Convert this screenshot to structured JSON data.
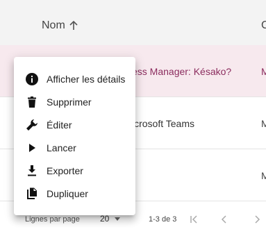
{
  "table": {
    "columns": {
      "name": "Nom",
      "next": "C"
    },
    "rows": [
      {
        "title": "ess Manager: Késako?",
        "c": "M"
      },
      {
        "title": "icrosoft Teams",
        "c": "M"
      },
      {
        "title": "",
        "c": "M"
      }
    ]
  },
  "menu": {
    "items": [
      {
        "label": "Afficher les détails",
        "icon": "info-icon"
      },
      {
        "label": "Supprimer",
        "icon": "trash-icon"
      },
      {
        "label": "Éditer",
        "icon": "wrench-icon"
      },
      {
        "label": "Lancer",
        "icon": "play-icon"
      },
      {
        "label": "Exporter",
        "icon": "download-icon"
      },
      {
        "label": "Dupliquer",
        "icon": "copy-icon"
      }
    ]
  },
  "pagination": {
    "rows_per_page_label": "Lignes par page",
    "rows_per_page_value": "20",
    "range": "1-3 de 3"
  },
  "colors": {
    "selected_row_bg": "#f7e9ee",
    "selected_row_text": "#8b2c5e",
    "header_bg": "#f3f3f3"
  }
}
